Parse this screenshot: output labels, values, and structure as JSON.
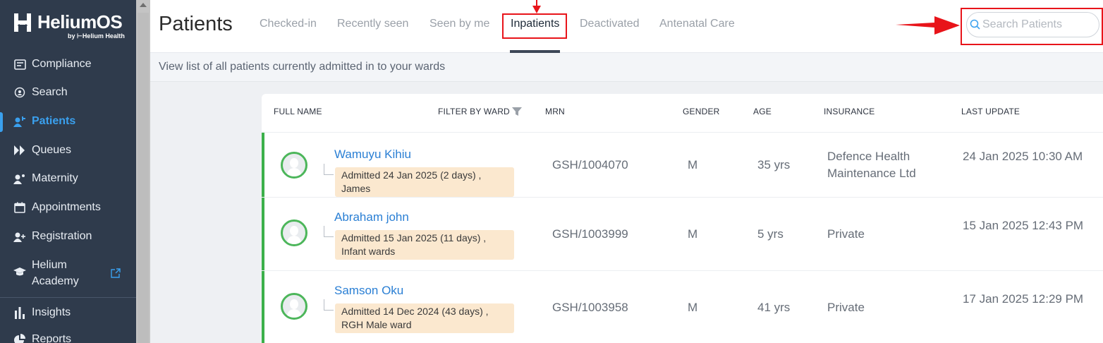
{
  "app": {
    "name": "HeliumOS",
    "by_text": "by",
    "company": "Helium Health"
  },
  "sidebar": {
    "items": [
      {
        "label": "Compliance",
        "icon": "compliance-icon"
      },
      {
        "label": "Search",
        "icon": "search-icon"
      },
      {
        "label": "Patients",
        "icon": "patients-icon",
        "active": true
      },
      {
        "label": "Queues",
        "icon": "queues-icon"
      },
      {
        "label": "Maternity",
        "icon": "maternity-icon"
      },
      {
        "label": "Appointments",
        "icon": "calendar-icon"
      },
      {
        "label": "Registration",
        "icon": "add-user-icon"
      },
      {
        "label": "Helium Academy",
        "icon": "graduation-cap-icon",
        "external": true
      },
      {
        "label": "Insights",
        "icon": "bar-chart-icon"
      },
      {
        "label": "Reports",
        "icon": "pie-chart-icon"
      }
    ]
  },
  "header": {
    "title": "Patients",
    "tabs": [
      {
        "label": "Checked-in"
      },
      {
        "label": "Recently seen"
      },
      {
        "label": "Seen by me"
      },
      {
        "label": "Inpatients",
        "active": true
      },
      {
        "label": "Deactivated"
      },
      {
        "label": "Antenatal Care"
      }
    ],
    "search": {
      "placeholder": "Search Patients",
      "value": ""
    }
  },
  "info": {
    "text": "View list of all patients currently admitted in to your wards"
  },
  "table": {
    "columns": [
      "FULL NAME",
      "FILTER BY WARD",
      "MRN",
      "GENDER",
      "AGE",
      "INSURANCE",
      "LAST UPDATE"
    ],
    "rows": [
      {
        "name": "Wamuyu Kihiu",
        "admission": "Admitted 24 Jan 2025 (2 days) , James",
        "mrn": "GSH/1004070",
        "gender": "M",
        "age": "35 yrs",
        "insurance": "Defence Health Maintenance Ltd",
        "last_update": "24 Jan 2025 10:30 AM"
      },
      {
        "name": "Abraham john",
        "admission": "Admitted 15 Jan 2025 (11 days) , Infant wards",
        "mrn": "GSH/1003999",
        "gender": "M",
        "age": "5 yrs",
        "insurance": "Private",
        "last_update": "15 Jan 2025 12:43 PM"
      },
      {
        "name": "Samson Oku",
        "admission": "Admitted 14 Dec 2024 (43 days) , RGH Male ward",
        "mrn": "GSH/1003958",
        "gender": "M",
        "age": "41 yrs",
        "insurance": "Private",
        "last_update": "17 Jan 2025 12:29 PM"
      }
    ]
  },
  "colors": {
    "sidebar_bg": "#2f3b4c",
    "accent": "#3aa0ee",
    "link": "#2a7fd4",
    "status_bar": "#3cb04a",
    "badge_bg": "#fbe8cf",
    "annotation": "#e8141a"
  }
}
